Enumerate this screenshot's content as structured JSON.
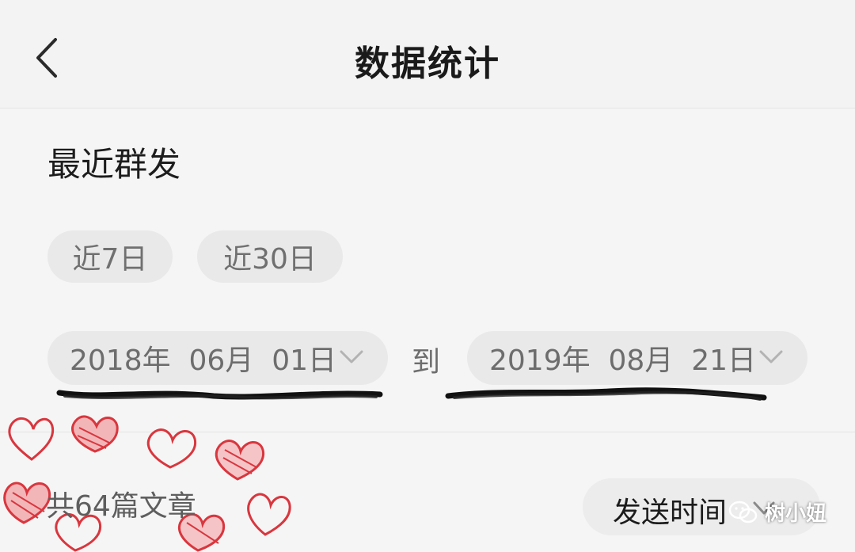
{
  "header": {
    "title": "数据统计",
    "back_icon": "chevron-left-icon"
  },
  "section": {
    "title": "最近群发"
  },
  "quick_ranges": [
    {
      "label": "近7日"
    },
    {
      "label": "近30日"
    }
  ],
  "date_range": {
    "start": "2018年  06月  01日",
    "separator": "到",
    "end": "2019年  08月  21日",
    "dropdown_icon": "chevron-down-icon"
  },
  "summary": {
    "article_count": "共64篇文章"
  },
  "sort": {
    "label": "发送时间",
    "icon": "chevron-down-icon"
  },
  "watermark": {
    "text": "树小妞",
    "icon": "wechat-icon"
  },
  "colors": {
    "background": "#f5f5f5",
    "pill": "#e9e9e9",
    "heart_red": "#d9363e",
    "scribble": "#111111"
  }
}
